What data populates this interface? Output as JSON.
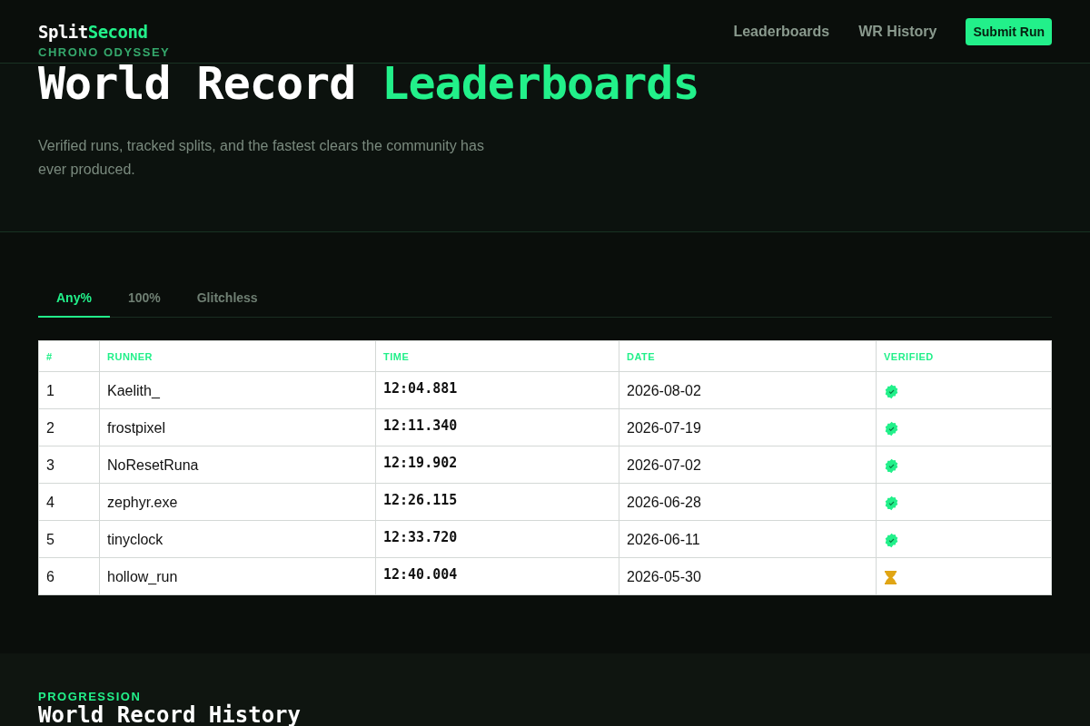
{
  "header": {
    "logo": {
      "first": "Split",
      "second": "Second"
    },
    "nav": [
      {
        "label": "Leaderboards"
      },
      {
        "label": "WR History"
      }
    ],
    "cta": "Submit Run"
  },
  "hero": {
    "eyebrow": "CHRONO ODYSSEY",
    "title_plain": "World Record ",
    "title_accent": "Leaderboards",
    "subtitle": "Verified runs, tracked splits, and the fastest clears the community has ever produced."
  },
  "tabs": [
    {
      "label": "Any%",
      "selected": true
    },
    {
      "label": "100%",
      "selected": false
    },
    {
      "label": "Glitchless",
      "selected": false
    }
  ],
  "table": {
    "columns": [
      "#",
      "RUNNER",
      "TIME",
      "DATE",
      "VERIFIED"
    ],
    "rows": [
      {
        "rank": "1",
        "runner": "Kaelith_",
        "time": "12:04.881",
        "date": "2026-08-02",
        "verified": true
      },
      {
        "rank": "2",
        "runner": "frostpixel",
        "time": "12:11.340",
        "date": "2026-07-19",
        "verified": true
      },
      {
        "rank": "3",
        "runner": "NoResetRuna",
        "time": "12:19.902",
        "date": "2026-07-02",
        "verified": true
      },
      {
        "rank": "4",
        "runner": "zephyr.exe",
        "time": "12:26.115",
        "date": "2026-06-28",
        "verified": true
      },
      {
        "rank": "5",
        "runner": "tinyclock",
        "time": "12:33.720",
        "date": "2026-06-11",
        "verified": true
      },
      {
        "rank": "6",
        "runner": "hollow_run",
        "time": "12:40.004",
        "date": "2026-05-30",
        "verified": false
      }
    ]
  },
  "history": {
    "eyebrow": "PROGRESSION",
    "title": "World Record History"
  }
}
